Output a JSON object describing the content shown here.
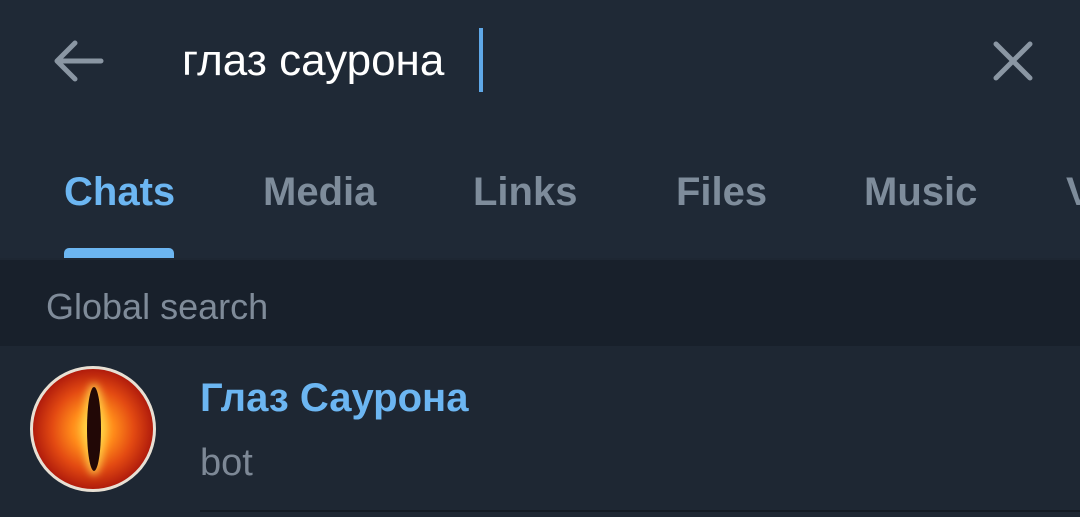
{
  "search": {
    "query": "глаз саурона",
    "back_icon": "arrow-left-icon",
    "close_icon": "close-icon"
  },
  "tabs": [
    {
      "label": "Chats",
      "active": true
    },
    {
      "label": "Media",
      "active": false
    },
    {
      "label": "Links",
      "active": false
    },
    {
      "label": "Files",
      "active": false
    },
    {
      "label": "Music",
      "active": false
    },
    {
      "label": "V",
      "active": false
    }
  ],
  "section": {
    "title": "Global search"
  },
  "results": [
    {
      "name": "Глаз Саурона",
      "subtitle": "bot"
    }
  ],
  "colors": {
    "accent": "#6cb6f2",
    "background": "#1e2733",
    "section_bg": "#18202b"
  }
}
